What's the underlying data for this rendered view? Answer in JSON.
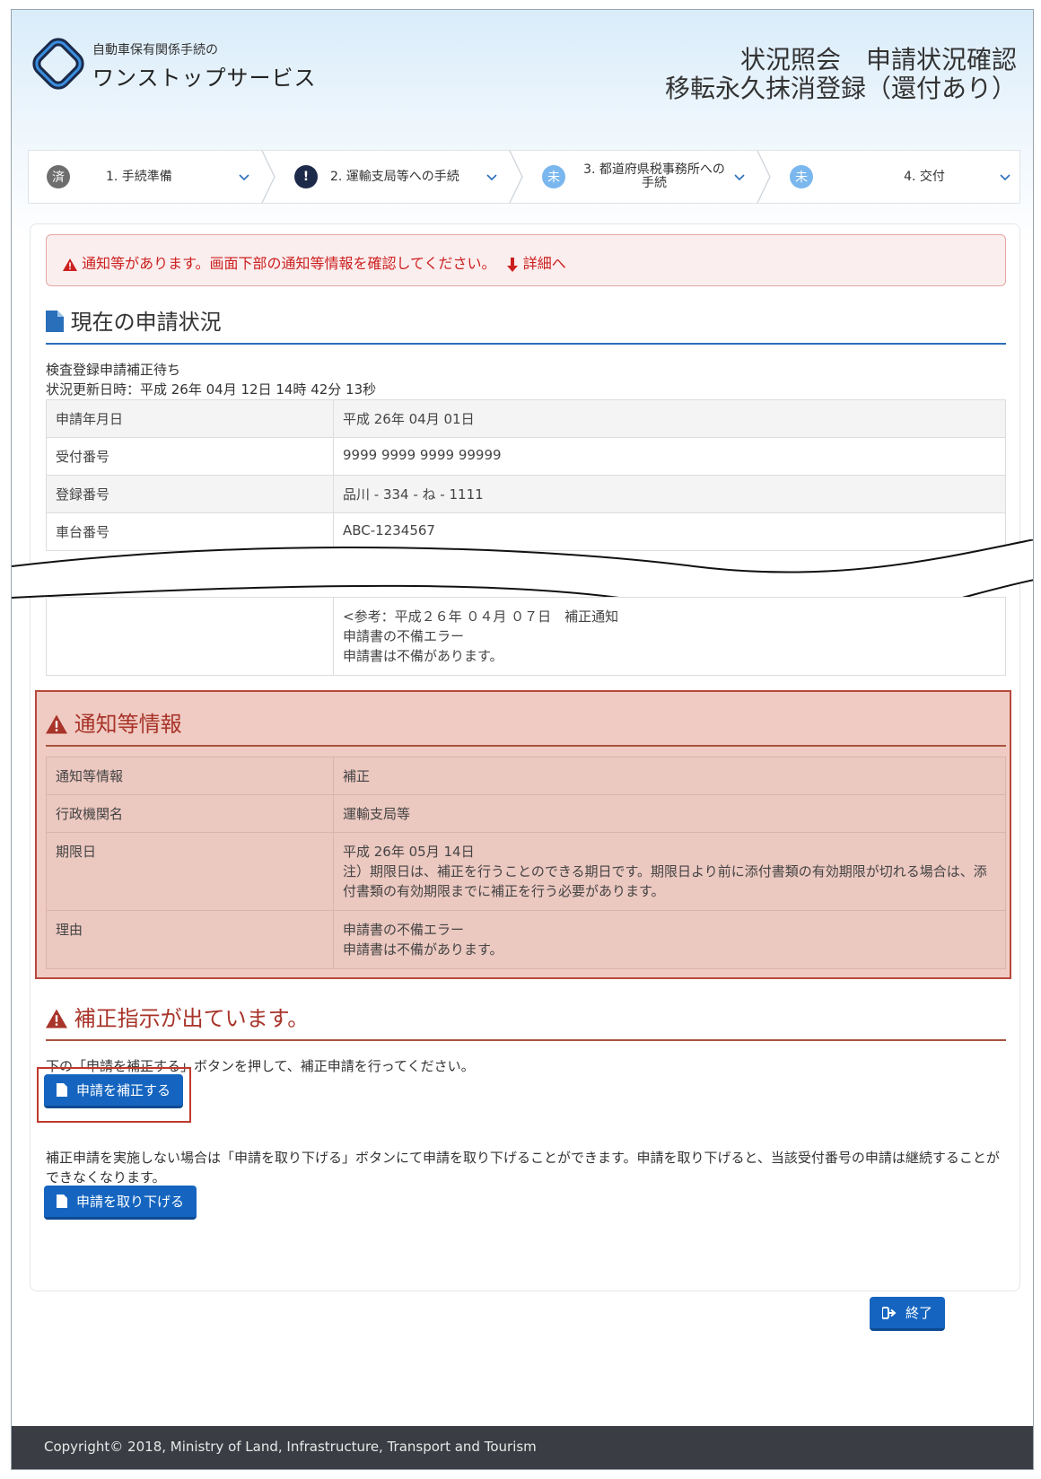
{
  "header": {
    "logo_sub": "自動車保有関係手続の",
    "logo_main": "ワンストップサービス",
    "title_line1": "状況照会　申請状況確認",
    "title_line2": "移転永久抹消登録（還付あり）"
  },
  "steps": [
    {
      "badge": "済",
      "label": "1. 手続準備",
      "state": "done"
    },
    {
      "badge": "!",
      "label": "2. 運輸支局等への手続",
      "state": "warn"
    },
    {
      "badge": "未",
      "label": "3. 都道府県税事務所への手続",
      "state": "todo"
    },
    {
      "badge": "未",
      "label": "4. 交付",
      "state": "todo"
    }
  ],
  "alert": {
    "text": "通知等があります。画面下部の通知等情報を確認してください。",
    "link": "詳細へ"
  },
  "current_status": {
    "title": "現在の申請状況",
    "status": "検査登録申請補正待ち",
    "updated": "状況更新日時：平成 26年 04月 12日 14時 42分 13秒",
    "rows": [
      {
        "key": "申請年月日",
        "value": "平成 26年 04月 01日"
      },
      {
        "key": "受付番号",
        "value": "9999 9999 9999 99999"
      },
      {
        "key": "登録番号",
        "value": "品川 - 334 - ね - 1111"
      },
      {
        "key": "車台番号",
        "value": "ABC-1234567"
      }
    ],
    "cut_row": {
      "line1": "<参考：平成２６年 ０４月 ０７日　補正通知",
      "line2": "申請書の不備エラー",
      "line3": "申請書は不備があります。"
    }
  },
  "notice": {
    "title": "通知等情報",
    "rows": [
      {
        "key": "通知等情報",
        "value": "補正"
      },
      {
        "key": "行政機関名",
        "value": "運輸支局等"
      },
      {
        "key": "期限日",
        "value": "平成 26年 05月 14日",
        "note": "注）期限日は、補正を行うことのできる期日です。期限日より前に添付書類の有効期限が切れる場合は、添付書類の有効期限までに補正を行う必要があります。"
      },
      {
        "key": "理由",
        "value": "申請書の不備エラー",
        "value2": "申請書は不備があります。"
      }
    ]
  },
  "hosei": {
    "title": "補正指示が出ています。",
    "text": "下の「申請を補正する」ボタンを押して、補正申請を行ってください。",
    "button": "申請を補正する",
    "withdraw_text": "補正申請を実施しない場合は「申請を取り下げる」ボタンにて申請を取り下げることができます。申請を取り下げると、当該受付番号の申請は継続することができなくなります。",
    "withdraw_button": "申請を取り下げる"
  },
  "exit_button": "終了",
  "footer": "Copyright© 2018, Ministry of Land, Infrastructure, Transport and Tourism",
  "colors": {
    "primary": "#1565c0",
    "alert_red": "#cc1f1f",
    "notice_bg": "#f0cbc3",
    "footer_bg": "#3a3e44"
  }
}
